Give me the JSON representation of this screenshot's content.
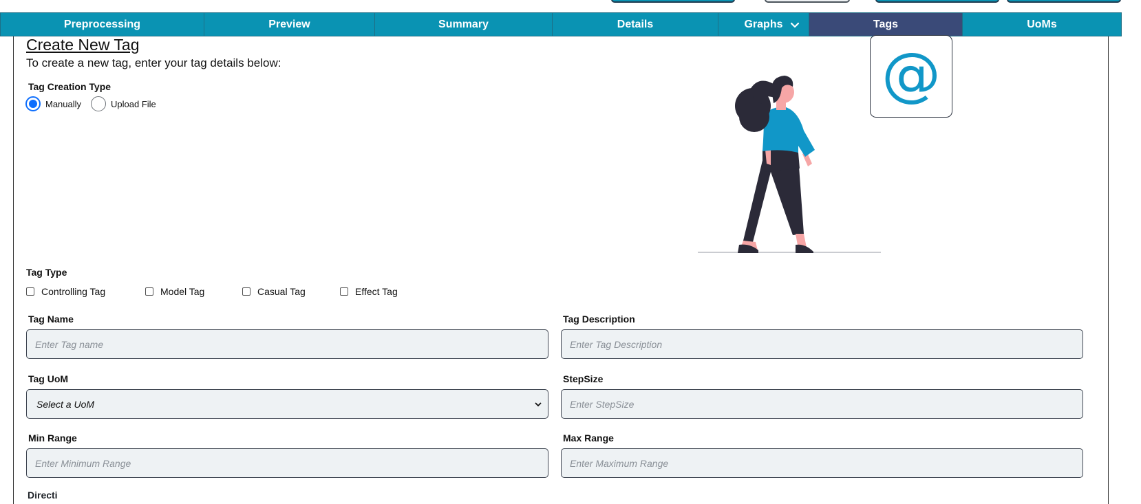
{
  "tabs": [
    {
      "label": "Preprocessing",
      "active": false
    },
    {
      "label": "Preview",
      "active": false
    },
    {
      "label": "Summary",
      "active": false
    },
    {
      "label": "Details",
      "active": false
    },
    {
      "label": "Graphs",
      "active": false
    },
    {
      "label": "Tags",
      "active": true
    },
    {
      "label": "UoMs",
      "active": false
    }
  ],
  "form": {
    "title": "Create New Tag",
    "subtitle": "To create a new tag, enter your tag details below:",
    "creation_type_label": "Tag Creation Type",
    "creation_options": [
      "Manually",
      "Upload File"
    ],
    "creation_selected": "Manually",
    "tag_type_label": "Tag Type",
    "tag_types": [
      "Controlling Tag",
      "Model Tag",
      "Casual Tag",
      "Effect Tag"
    ],
    "tag_name_label": "Tag Name",
    "tag_name_placeholder": "Enter Tag name",
    "tag_desc_label": "Tag Description",
    "tag_desc_placeholder": "Enter Tag Description",
    "tag_uom_label": "Tag UoM",
    "tag_uom_selected": "Select a UoM",
    "stepsize_label": "StepSize",
    "stepsize_placeholder": "Enter StepSize",
    "min_label": "Min Range",
    "min_placeholder": "Enter Minimum Range",
    "max_label": "Max Range",
    "max_placeholder": "Enter Maximum Range",
    "next_label_partial": "Directi"
  },
  "illustration": {
    "at_symbol": "@"
  },
  "colors": {
    "tab_bg": "#0a93b3",
    "tab_active": "#3a4a78",
    "accent": "#0d6efd",
    "illustration_shirt": "#1197c8",
    "illustration_dark": "#2b2a38"
  }
}
